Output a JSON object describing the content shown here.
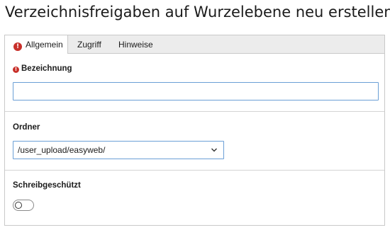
{
  "page": {
    "title": "Verzeichnisfreigaben auf Wurzelebene neu erstellen"
  },
  "tabs": [
    {
      "label": "Allgemein",
      "active": true,
      "has_error": true
    },
    {
      "label": "Zugriff",
      "active": false,
      "has_error": false
    },
    {
      "label": "Hinweise",
      "active": false,
      "has_error": false
    }
  ],
  "icons": {
    "error": "!"
  },
  "fields": {
    "bezeichnung": {
      "label": "Bezeichnung",
      "required": true,
      "value": ""
    },
    "ordner": {
      "label": "Ordner",
      "selected": "/user_upload/easyweb/"
    },
    "schreibgeschuetzt": {
      "label": "Schreibgeschützt",
      "checked": false
    }
  },
  "colors": {
    "error": "#c8302a",
    "focus_border": "#6b9fd6",
    "tabbar_bg": "#ececec"
  }
}
